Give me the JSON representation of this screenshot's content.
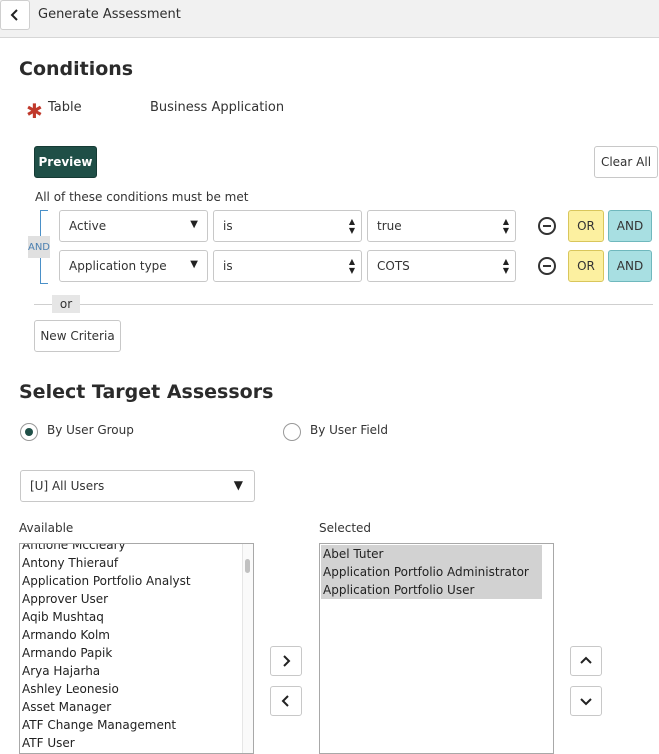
{
  "header": {
    "title": "Generate Assessment",
    "back_icon": "chevron-left-icon"
  },
  "conditions": {
    "heading": "Conditions",
    "table_label": "Table",
    "table_value": "Business Application",
    "preview_label": "Preview",
    "clear_all_label": "Clear All",
    "must_be_met": "All of these conditions must be met",
    "and_badge": "AND",
    "rows": [
      {
        "field": "Active",
        "operator": "is",
        "value": "true",
        "or_label": "OR",
        "and_label": "AND"
      },
      {
        "field": "Application type",
        "operator": "is",
        "value": "COTS",
        "or_label": "OR",
        "and_label": "AND"
      }
    ],
    "or_separator": "or",
    "new_criteria_label": "New Criteria"
  },
  "assessors": {
    "heading": "Select Target Assessors",
    "radio_group": {
      "label": "By User Group",
      "selected": true
    },
    "radio_field": {
      "label": "By User Field",
      "selected": false
    },
    "group_select_value": "[U] All Users",
    "available_label": "Available",
    "selected_label": "Selected",
    "available_items": [
      "Antione Mccleary",
      "Antony Thierauf",
      "Application Portfolio Analyst",
      "Approver User",
      "Aqib Mushtaq",
      "Armando Kolm",
      "Armando Papik",
      "Arya Hajarha",
      "Ashley Leonesio",
      "Asset Manager",
      "ATF Change Management",
      "ATF User"
    ],
    "selected_items": [
      "Abel Tuter",
      "Application Portfolio Administrator",
      "Application Portfolio User"
    ]
  },
  "colors": {
    "primary": "#1f4f47",
    "or_button": "#fcf0a0",
    "and_button": "#a8dfe2",
    "required": "#c0392b"
  }
}
